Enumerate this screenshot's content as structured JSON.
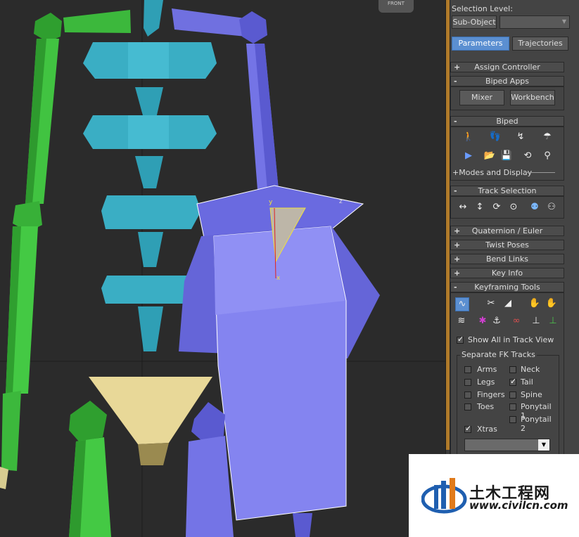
{
  "viewport": {
    "label": "FRONT",
    "gizmo_axes": [
      "y",
      "z",
      "x"
    ]
  },
  "panel": {
    "selection_level_label": "Selection Level:",
    "sub_object_label": "Sub-Object",
    "tabs": [
      {
        "label": "Parameters",
        "active": true
      },
      {
        "label": "Trajectories",
        "active": false
      }
    ],
    "assign_controller": {
      "sign": "+",
      "title": "Assign Controller"
    },
    "biped_apps": {
      "sign": "-",
      "title": "Biped Apps",
      "mixer_label": "Mixer",
      "workbench_label": "Workbench"
    },
    "biped": {
      "sign": "-",
      "title": "Biped",
      "modes_label": "+Modes and Display"
    },
    "track_selection": {
      "sign": "-",
      "title": "Track Selection"
    },
    "quaternion": {
      "sign": "+",
      "title": "Quaternion / Euler"
    },
    "twist_poses": {
      "sign": "+",
      "title": "Twist Poses"
    },
    "bend_links": {
      "sign": "+",
      "title": "Bend Links"
    },
    "key_info": {
      "sign": "+",
      "title": "Key Info"
    },
    "keyframing_tools": {
      "sign": "-",
      "title": "Keyframing Tools",
      "show_all_label": "Show All in Track View",
      "show_all_checked": true,
      "separate_fk": {
        "title": "Separate FK Tracks",
        "left": [
          {
            "label": "Arms",
            "checked": false
          },
          {
            "label": "Legs",
            "checked": false
          },
          {
            "label": "Fingers",
            "checked": false
          },
          {
            "label": "Toes",
            "checked": false
          }
        ],
        "right": [
          {
            "label": "Neck",
            "checked": false
          },
          {
            "label": "Tail",
            "checked": true
          },
          {
            "label": "Spine",
            "checked": false
          },
          {
            "label": "Ponytail 1",
            "checked": false
          },
          {
            "label": "Ponytail 2",
            "checked": false
          }
        ],
        "xtras": {
          "label": "Xtras",
          "checked": true
        }
      }
    }
  },
  "watermark": {
    "text_cn": "土木工程网",
    "url": "www.civilcn.com"
  },
  "colors": {
    "accent": "#5b8fd1",
    "green_bone": "#3cb83c",
    "cyan_bone": "#3aa9bf",
    "purple_bone": "#7070e0",
    "pelvis": "#e8d898"
  }
}
